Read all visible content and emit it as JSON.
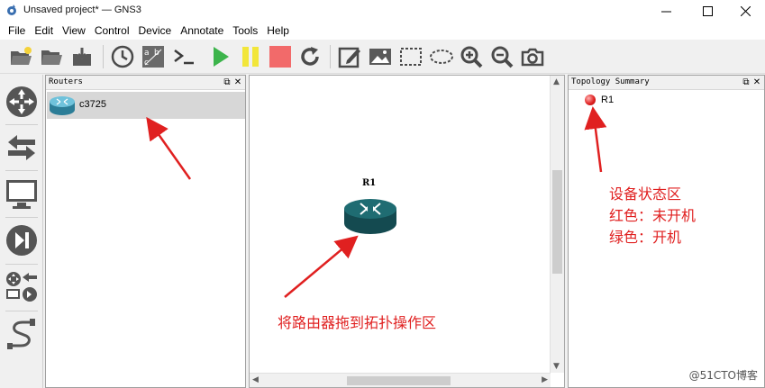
{
  "window": {
    "title": "Unsaved project* — GNS3"
  },
  "menu": [
    "File",
    "Edit",
    "View",
    "Control",
    "Device",
    "Annotate",
    "Tools",
    "Help"
  ],
  "toolbar": {
    "icons": [
      "open-project-icon",
      "open-folder-icon",
      "save-icon",
      "snapshot-clock-icon",
      "show-interface-labels-icon",
      "console-icon",
      "start-icon",
      "pause-icon",
      "stop-icon",
      "reload-icon",
      "add-note-icon",
      "insert-picture-icon",
      "draw-rectangle-icon",
      "draw-ellipse-icon",
      "zoom-in-icon",
      "zoom-out-icon",
      "screenshot-icon"
    ]
  },
  "devices_dock": {
    "title": "Routers",
    "items": [
      {
        "label": "c3725"
      }
    ]
  },
  "canvas": {
    "nodes": [
      {
        "label": "R1"
      }
    ]
  },
  "topology_summary": {
    "title": "Topology Summary",
    "items": [
      {
        "label": "R1",
        "status_color": "#e12424"
      }
    ]
  },
  "annotations": {
    "status_lines": [
      "设备状态区",
      "红色：未开机",
      "绿色：开机"
    ],
    "drag_hint": "将路由器拖到拓扑操作区",
    "color": "#e02020"
  },
  "watermark": "@51CTO博客"
}
